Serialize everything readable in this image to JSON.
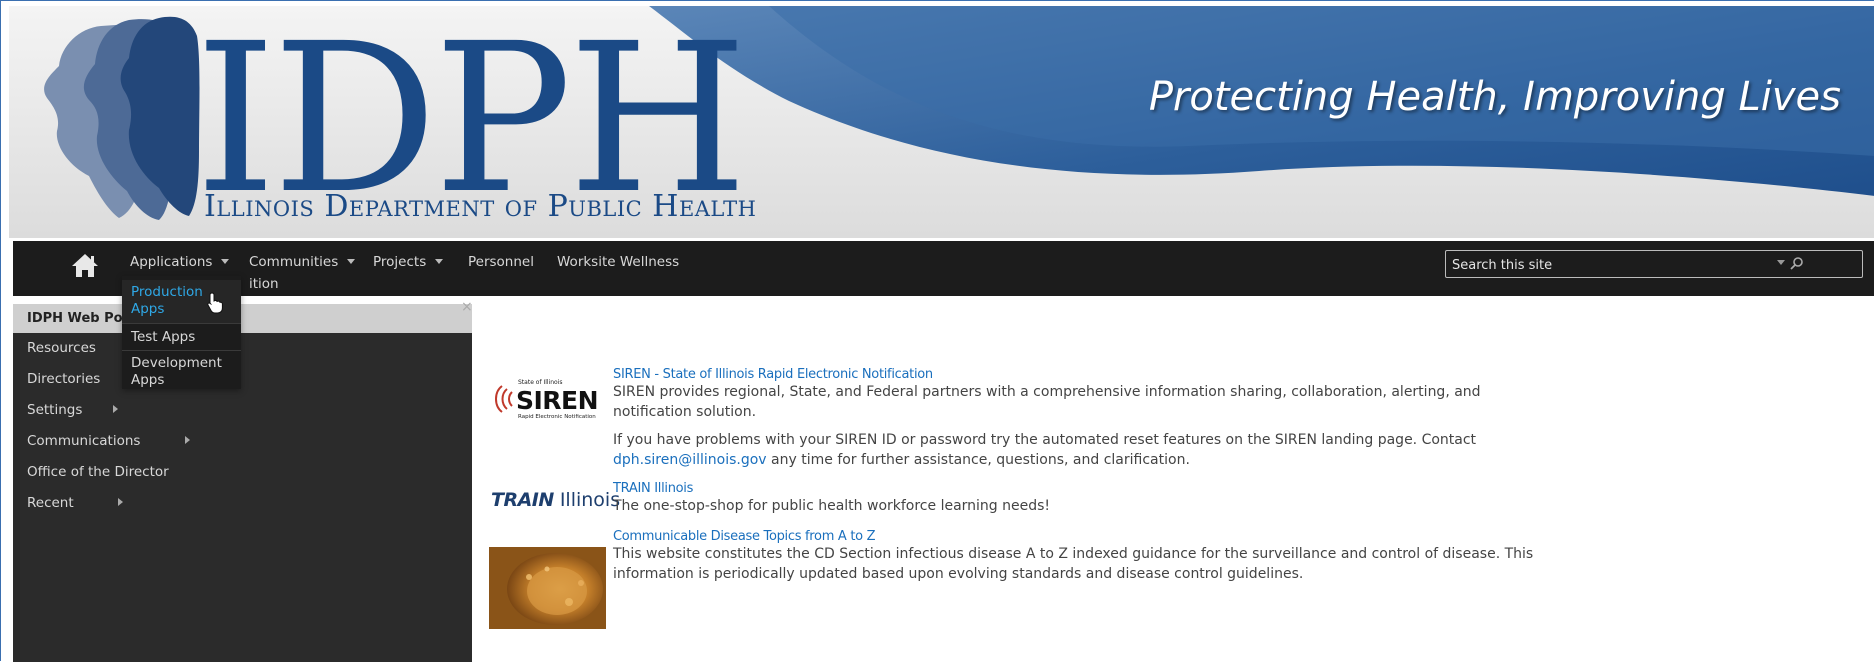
{
  "banner": {
    "logo_text": "IDPH",
    "subtitle": "Illinois Department of Public Health",
    "tagline": "Protecting Health, Improving Lives"
  },
  "nav": {
    "home_icon": "home-icon",
    "items": [
      {
        "label": "Applications",
        "has_dropdown": true
      },
      {
        "label": "Communities",
        "has_dropdown": true
      },
      {
        "label": "Projects",
        "has_dropdown": true
      },
      {
        "label": "Personnel",
        "has_dropdown": false
      },
      {
        "label": "Worksite Wellness",
        "has_dropdown": false
      }
    ],
    "sub_fragment": "ition",
    "search": {
      "placeholder": "Search this site",
      "value": ""
    }
  },
  "dropdown": {
    "items": [
      "Production Apps",
      "Test Apps",
      "Development Apps"
    ],
    "active": "Production Apps",
    "active_color": "#2fa8e6"
  },
  "sidebar": {
    "title": "IDPH Web Por",
    "close_glyph": "×",
    "items": [
      {
        "label": "Resources",
        "has_submenu": false
      },
      {
        "label": "Directories",
        "has_submenu": false
      },
      {
        "label": "Settings",
        "has_submenu": true
      },
      {
        "label": "Communications",
        "has_submenu": true
      },
      {
        "label": "Office of the Director",
        "has_submenu": false
      },
      {
        "label": "Recent",
        "has_submenu": true
      }
    ]
  },
  "content": {
    "siren": {
      "logo_top": "State of Illinois",
      "logo_word": "SIREN",
      "logo_bottom": "Rapid Electronic Notification",
      "link": "SIREN - State of Illinois Rapid Electronic Notification",
      "desc": "SIREN provides regional, State, and Federal partners with a comprehensive information sharing, collaboration, alerting, and notification solution.",
      "help_before": "If you have problems with your SIREN ID or password try the automated reset features on the SIREN landing page. Contact",
      "help_email": "dph.siren@illinois.gov",
      "help_after": "any time for further assistance, questions, and clarification."
    },
    "train": {
      "logo_word": "TRAIN",
      "logo_state": "Illinois",
      "link": "TRAIN Illinois",
      "desc": "The one-stop-shop for public health workforce learning needs!"
    },
    "cd": {
      "link": "Communicable Disease Topics from A to Z",
      "desc": "This website constitutes the CD Section infectious disease A to Z indexed guidance for the surveillance and control of disease. This information is periodically updated based upon evolving standards and disease control guidelines."
    }
  },
  "colors": {
    "brand_blue": "#1b4a86",
    "nav_bg": "#1c1c1c",
    "link": "#1a6fbd",
    "sidebar_bg": "#2b2b2b"
  }
}
